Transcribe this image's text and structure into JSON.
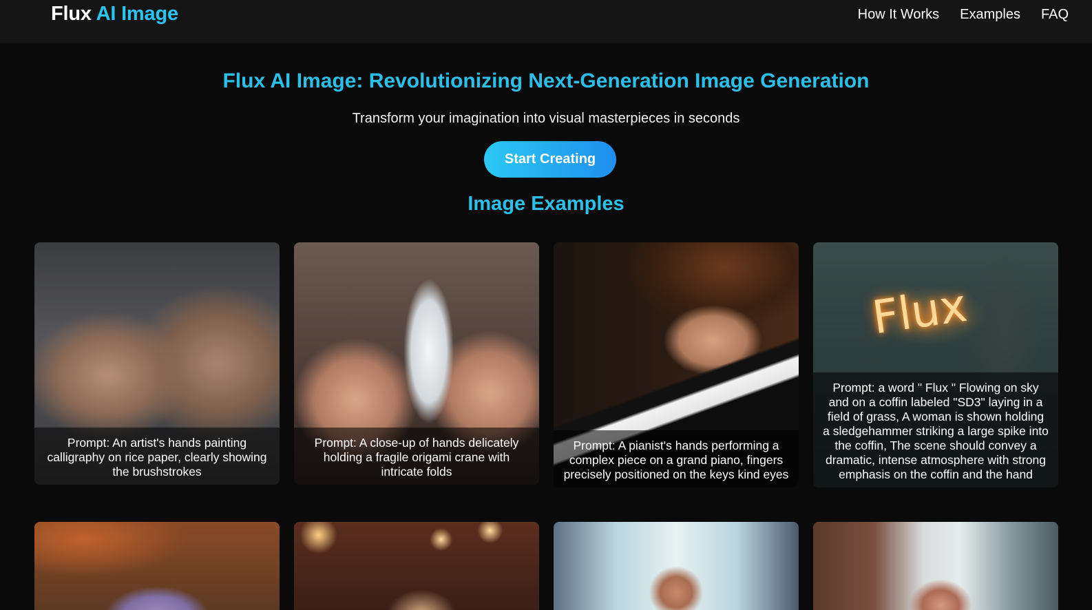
{
  "header": {
    "logo_main": "Flux",
    "logo_accent": "AI Image",
    "nav": [
      "How It Works",
      "Examples",
      "FAQ"
    ]
  },
  "hero": {
    "title": "Flux AI Image: Revolutionizing Next-Generation Image Generation",
    "subtitle": "Transform your imagination into visual masterpieces in seconds",
    "cta_label": "Start Creating"
  },
  "examples": {
    "title": "Image Examples",
    "cards": [
      {
        "caption": "Prompt: An artist's hands painting calligraphy on rice paper, clearly showing the brushstrokes"
      },
      {
        "caption": "Prompt: A close-up of hands delicately holding a fragile origami crane with intricate folds"
      },
      {
        "caption": "Prompt: A pianist's hands performing a complex piece on a grand piano, fingers precisely positioned on the keys kind eyes"
      },
      {
        "caption": "Prompt: a word \" Flux \" Flowing on sky and on a coffin labeled \"SD3\" laying in a field of grass, A woman is shown holding a sledgehammer striking a large spike into the coffin, The scene should convey a dramatic, intense atmosphere with strong emphasis on the coffin and the hand",
        "image_text": "Flux"
      }
    ]
  },
  "colors": {
    "accent": "#29c0ea",
    "background": "#0a0a0a",
    "header_bg": "#151515"
  }
}
